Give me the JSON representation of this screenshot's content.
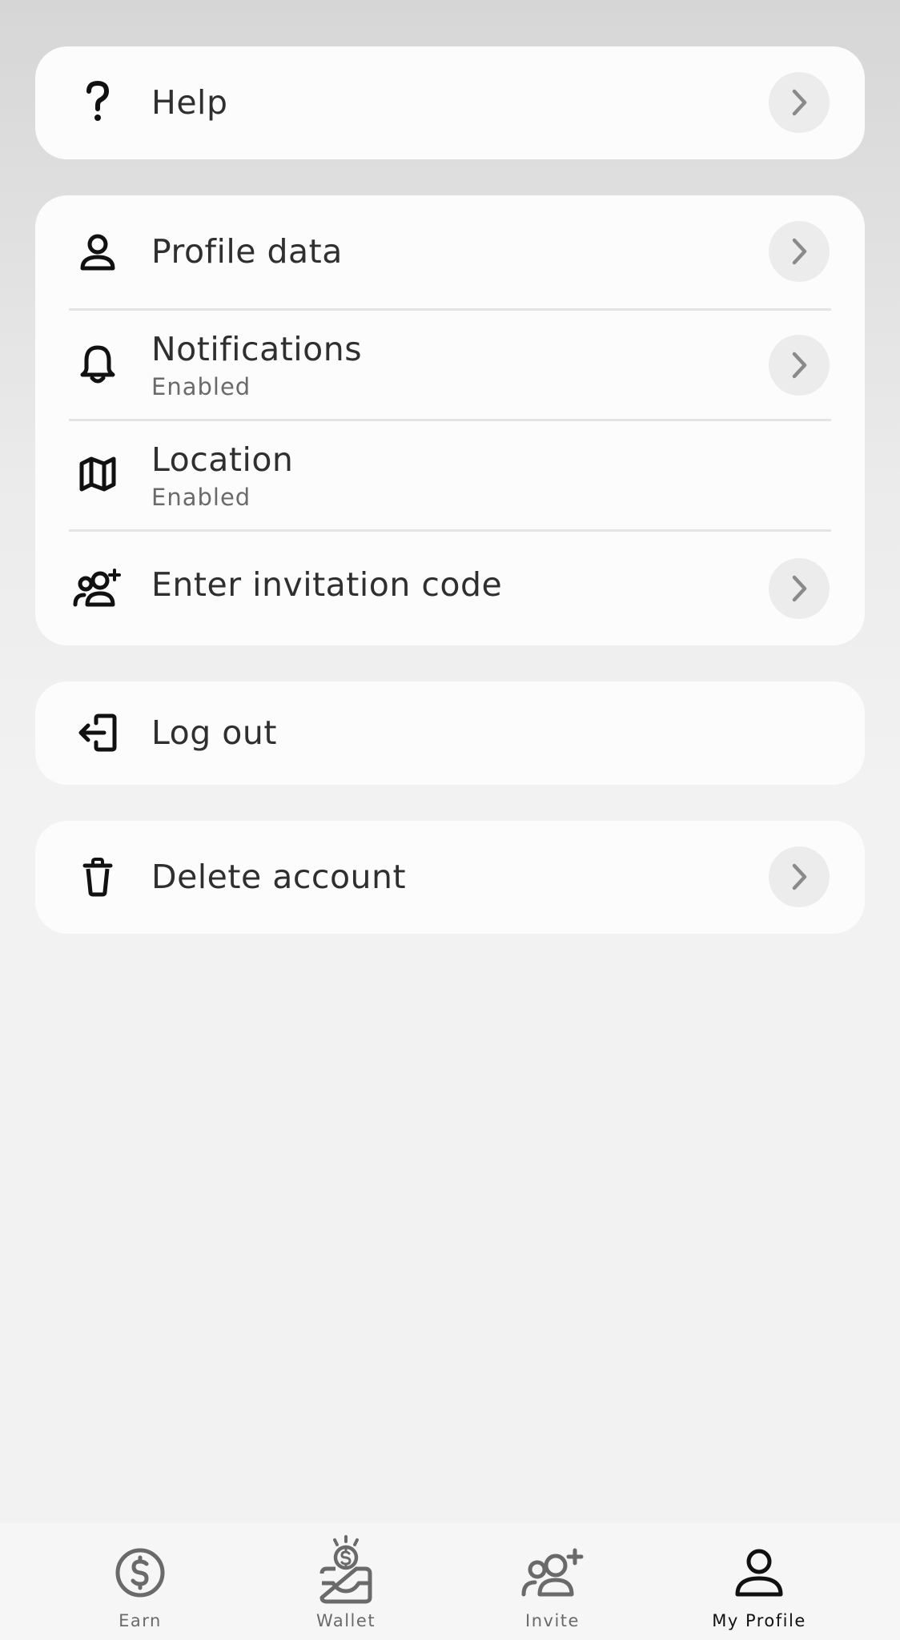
{
  "menu": {
    "help": {
      "label": "Help"
    },
    "profile_data": {
      "label": "Profile data"
    },
    "notifications": {
      "label": "Notifications",
      "status": "Enabled"
    },
    "location": {
      "label": "Location",
      "status": "Enabled"
    },
    "invitation": {
      "label": "Enter invitation code"
    },
    "logout": {
      "label": "Log out"
    },
    "delete_account": {
      "label": "Delete account"
    }
  },
  "tabbar": {
    "tabs": [
      {
        "label": "Earn",
        "icon": "dollar-circle-icon"
      },
      {
        "label": "Wallet",
        "icon": "wallet-coin-icon"
      },
      {
        "label": "Invite",
        "icon": "add-users-icon"
      },
      {
        "label": "My Profile",
        "icon": "person-icon",
        "active": true
      }
    ]
  },
  "colors": {
    "card": "#fcfcfc",
    "chevron_bg": "#ececec",
    "text": "#2f2f2f",
    "subtext": "#6a6a6a",
    "active_tab": "#111111"
  }
}
